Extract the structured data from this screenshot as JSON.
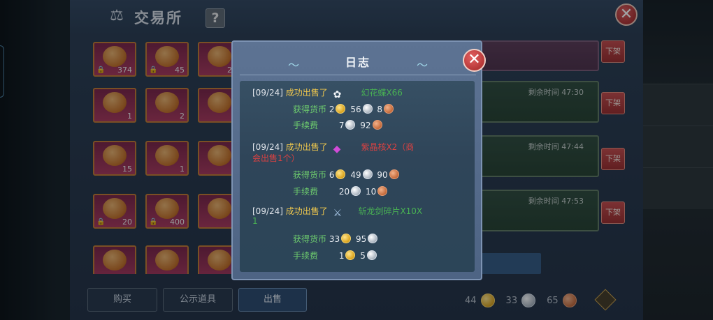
{
  "main": {
    "title": "交易所",
    "help_label": "?",
    "close_label": "✕"
  },
  "inventory": {
    "slots": [
      {
        "count": "374"
      },
      {
        "count": "45"
      },
      {
        "count": "20"
      },
      {
        "count": "1"
      },
      {
        "count": "2"
      },
      {
        "count": ""
      },
      {
        "count": "15"
      },
      {
        "count": "1"
      },
      {
        "count": ""
      },
      {
        "count": "20"
      },
      {
        "count": "400"
      },
      {
        "count": ""
      },
      {
        "count": ""
      },
      {
        "count": ""
      },
      {
        "count": ""
      }
    ]
  },
  "listings": [
    {
      "remaining_label": "",
      "remaining_time": ""
    },
    {
      "remaining_label": "剩余时间",
      "remaining_time": "47:30"
    },
    {
      "remaining_label": "剩余时间",
      "remaining_time": "47:44"
    },
    {
      "remaining_label": "剩余时间",
      "remaining_time": "47:53"
    }
  ],
  "delist_label": "下架",
  "bottom_tabs": {
    "buy": "购买",
    "public_items": "公示道具",
    "sell": "出售"
  },
  "currency": {
    "gold": "44",
    "silver": "33",
    "copper": "65"
  },
  "dialog": {
    "title": "日志",
    "close_label": "✕",
    "entries": [
      {
        "date": "[09/24]",
        "sold_label": "成功出售了",
        "item_name": "幻花蝶X66",
        "earned_label": "获得货币",
        "earned": {
          "gold": "2",
          "silver": "56",
          "copper": "8"
        },
        "fee_label": "手续费",
        "fee": {
          "silver": "7",
          "copper": "92"
        }
      },
      {
        "date": "[09/24]",
        "sold_label": "成功出售了",
        "item_name_line1": "紫晶核X2（商",
        "item_name_line2": "会出售1个）",
        "earned_label": "获得货币",
        "earned": {
          "gold": "6",
          "silver": "49",
          "copper": "90"
        },
        "fee_label": "手续费",
        "fee": {
          "silver": "20",
          "copper": "10"
        }
      },
      {
        "date": "[09/24]",
        "sold_label": "成功出售了",
        "item_name_line1": "斩龙剑碎片X10X",
        "item_name_line2": "1",
        "earned_label": "获得货币",
        "earned": {
          "gold": "33",
          "silver": "95"
        },
        "fee_label": "手续费",
        "fee": {
          "gold": "1",
          "silver": "5"
        }
      }
    ]
  }
}
